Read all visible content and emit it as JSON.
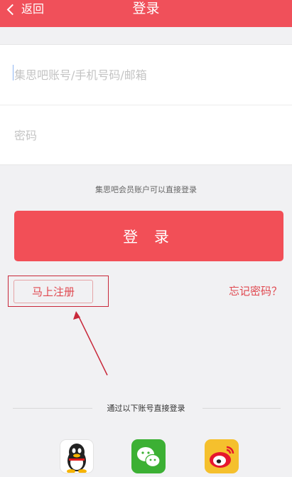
{
  "nav": {
    "back_label": "返回",
    "title": "登录"
  },
  "form": {
    "username_placeholder": "集思吧账号/手机号码/邮箱",
    "password_placeholder": "密码"
  },
  "hint": "集思吧会员账户可以直接登录",
  "login_button": "登 录",
  "register_button": "马上注册",
  "forgot_link": "忘记密码？",
  "third_party": {
    "label": "通过以下账号直接登录",
    "providers": [
      "qq-icon",
      "wechat-icon",
      "weibo-icon"
    ]
  },
  "colors": {
    "brand": "#f0505a",
    "button": "#f24f57",
    "annotation": "#c8283a"
  }
}
